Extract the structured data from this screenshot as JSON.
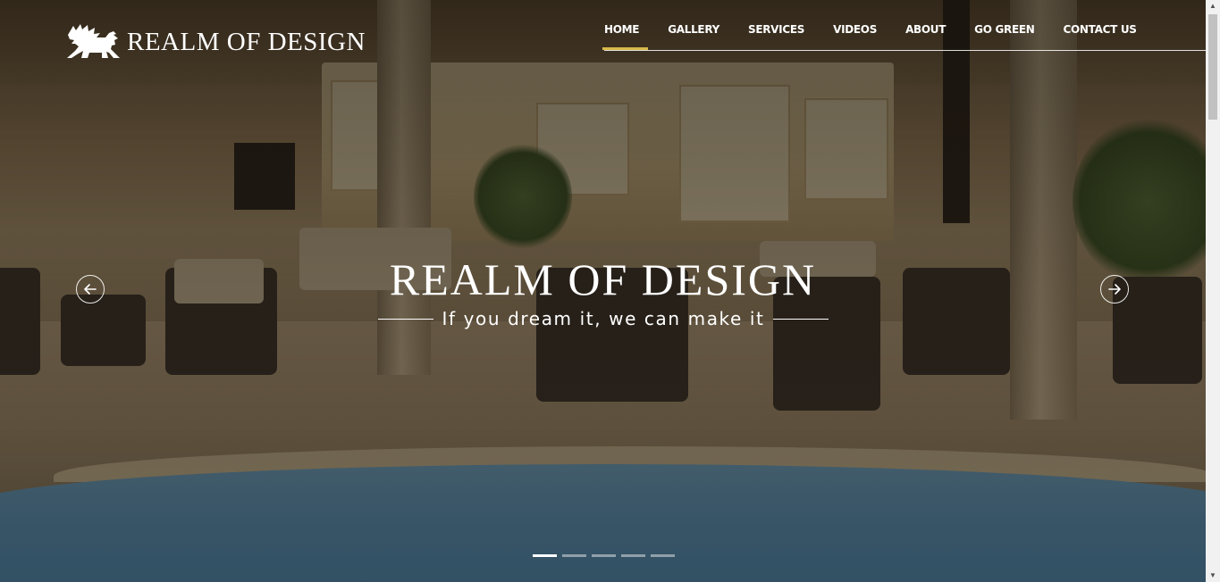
{
  "brand": {
    "name": "REALM OF DESIGN",
    "logo_icon": "winged-lion-icon"
  },
  "nav": {
    "items": [
      {
        "label": "HOME",
        "active": true
      },
      {
        "label": "GALLERY",
        "active": false
      },
      {
        "label": "SERVICES",
        "active": false
      },
      {
        "label": "VIDEOS",
        "active": false
      },
      {
        "label": "ABOUT",
        "active": false
      },
      {
        "label": "GO GREEN",
        "active": false
      },
      {
        "label": "CONTACT US",
        "active": false
      }
    ],
    "accent_color": "#d8b84a"
  },
  "hero": {
    "title": "REALM OF DESIGN",
    "subtitle": "If you dream it, we can make it",
    "prev_icon": "arrow-left-circle-icon",
    "next_icon": "arrow-right-circle-icon"
  },
  "slider": {
    "slide_count": 5,
    "active_index": 0
  },
  "scrollbar": {
    "up_glyph": "▲",
    "down_glyph": "▼"
  }
}
